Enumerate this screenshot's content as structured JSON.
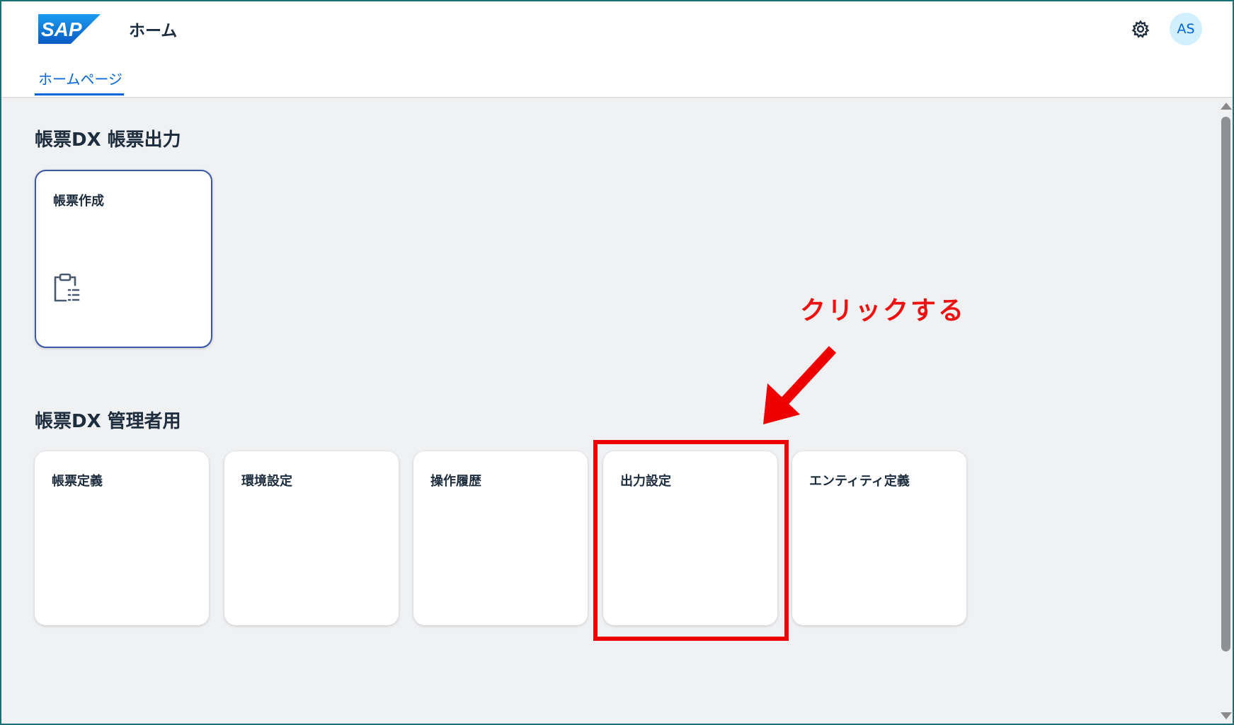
{
  "header": {
    "logo_text": "SAP",
    "app_title": "ホーム",
    "avatar_initials": "AS"
  },
  "tabs": [
    {
      "label": "ホームページ",
      "selected": true
    }
  ],
  "sections": [
    {
      "title": "帳票DX 帳票出力",
      "tiles": [
        {
          "title": "帳票作成",
          "icon": "clipboard-list-icon"
        }
      ]
    },
    {
      "title": "帳票DX 管理者用",
      "tiles": [
        {
          "title": "帳票定義"
        },
        {
          "title": "環境設定"
        },
        {
          "title": "操作履歴"
        },
        {
          "title": "出力設定"
        },
        {
          "title": "エンティティ定義"
        }
      ]
    }
  ],
  "annotation": {
    "text": "クリックする",
    "color": "#ee0000"
  },
  "colors": {
    "accent": "#0064d9",
    "background": "#f0f1f3",
    "title_text": "#1d2d3e"
  }
}
